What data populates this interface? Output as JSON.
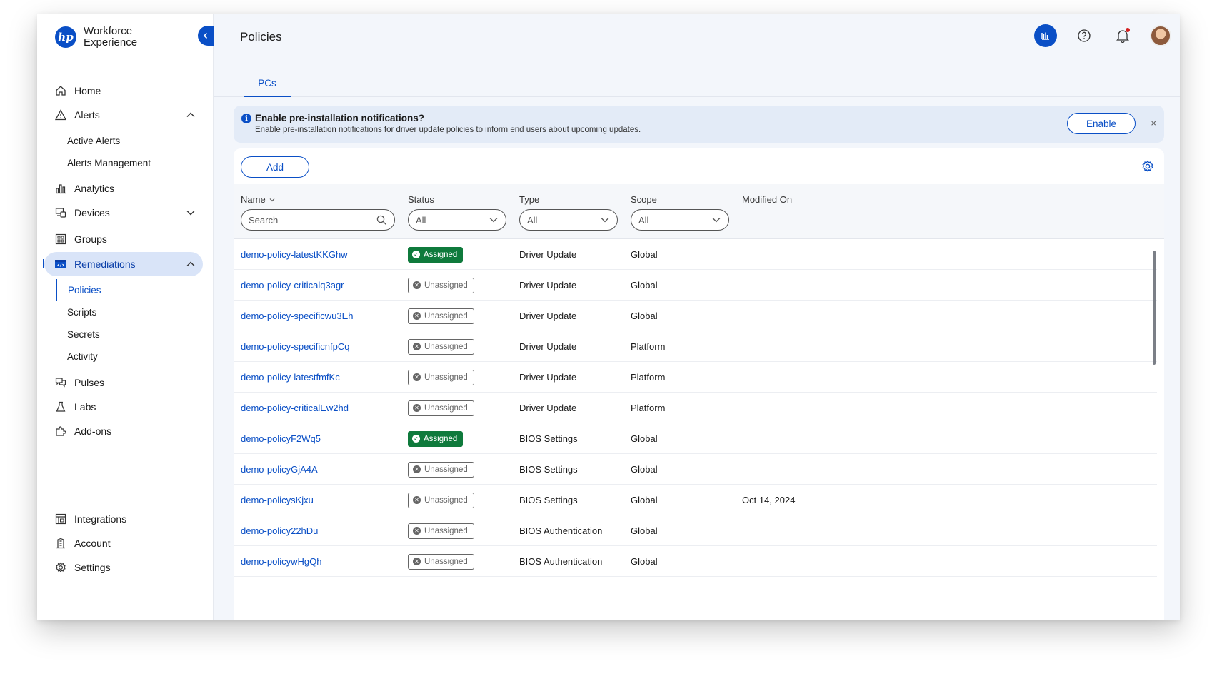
{
  "brand": {
    "line1": "Workforce",
    "line2": "Experience",
    "logo_text": "hp"
  },
  "sidebar": {
    "items": [
      {
        "label": "Home",
        "icon": "home-icon"
      },
      {
        "label": "Alerts",
        "icon": "alert-triangle-icon",
        "expanded": true
      },
      {
        "label": "Analytics",
        "icon": "bar-chart-icon"
      },
      {
        "label": "Devices",
        "icon": "devices-icon",
        "expanded": false
      },
      {
        "label": "Groups",
        "icon": "grid-icon"
      },
      {
        "label": "Remediations",
        "icon": "code-window-icon",
        "expanded": true,
        "active": true
      },
      {
        "label": "Pulses",
        "icon": "chat-bubbles-icon"
      },
      {
        "label": "Labs",
        "icon": "flask-icon"
      },
      {
        "label": "Add-ons",
        "icon": "puzzle-icon"
      },
      {
        "label": "Integrations",
        "icon": "integrations-icon"
      },
      {
        "label": "Account",
        "icon": "building-icon"
      },
      {
        "label": "Settings",
        "icon": "gear-icon"
      }
    ],
    "alerts_sub": [
      "Active Alerts",
      "Alerts Management"
    ],
    "remediations_sub": [
      "Policies",
      "Scripts",
      "Secrets",
      "Activity"
    ]
  },
  "header": {
    "title": "Policies"
  },
  "tabs": [
    {
      "label": "PCs",
      "active": true
    }
  ],
  "banner": {
    "title": "Enable pre-installation notifications?",
    "text": "Enable pre-installation notifications for driver update policies to inform end users about upcoming updates.",
    "button": "Enable",
    "close": "×"
  },
  "toolbar": {
    "add_label": "Add"
  },
  "table": {
    "columns": [
      "Name",
      "Status",
      "Type",
      "Scope",
      "Modified On"
    ],
    "filters": {
      "name_placeholder": "Search",
      "status": "All",
      "type": "All",
      "scope": "All"
    },
    "rows": [
      {
        "name": "demo-policy-latestKKGhw",
        "status": "Assigned",
        "type": "Driver Update",
        "scope": "Global",
        "modified": ""
      },
      {
        "name": "demo-policy-criticalq3agr",
        "status": "Unassigned",
        "type": "Driver Update",
        "scope": "Global",
        "modified": ""
      },
      {
        "name": "demo-policy-specificwu3Eh",
        "status": "Unassigned",
        "type": "Driver Update",
        "scope": "Global",
        "modified": ""
      },
      {
        "name": "demo-policy-specificnfpCq",
        "status": "Unassigned",
        "type": "Driver Update",
        "scope": "Platform",
        "modified": ""
      },
      {
        "name": "demo-policy-latestfmfKc",
        "status": "Unassigned",
        "type": "Driver Update",
        "scope": "Platform",
        "modified": ""
      },
      {
        "name": "demo-policy-criticalEw2hd",
        "status": "Unassigned",
        "type": "Driver Update",
        "scope": "Platform",
        "modified": ""
      },
      {
        "name": "demo-policyF2Wq5",
        "status": "Assigned",
        "type": "BIOS Settings",
        "scope": "Global",
        "modified": ""
      },
      {
        "name": "demo-policyGjA4A",
        "status": "Unassigned",
        "type": "BIOS Settings",
        "scope": "Global",
        "modified": ""
      },
      {
        "name": "demo-policysKjxu",
        "status": "Unassigned",
        "type": "BIOS Settings",
        "scope": "Global",
        "modified": "Oct 14, 2024"
      },
      {
        "name": "demo-policy22hDu",
        "status": "Unassigned",
        "type": "BIOS Authentication",
        "scope": "Global",
        "modified": ""
      },
      {
        "name": "demo-policywHgQh",
        "status": "Unassigned",
        "type": "BIOS Authentication",
        "scope": "Global",
        "modified": ""
      }
    ]
  },
  "colors": {
    "accent": "#0a4fc6",
    "assigned": "#0f7a3c",
    "active_nav_bg": "#d9e4f8",
    "notification_dot": "#d32020"
  }
}
